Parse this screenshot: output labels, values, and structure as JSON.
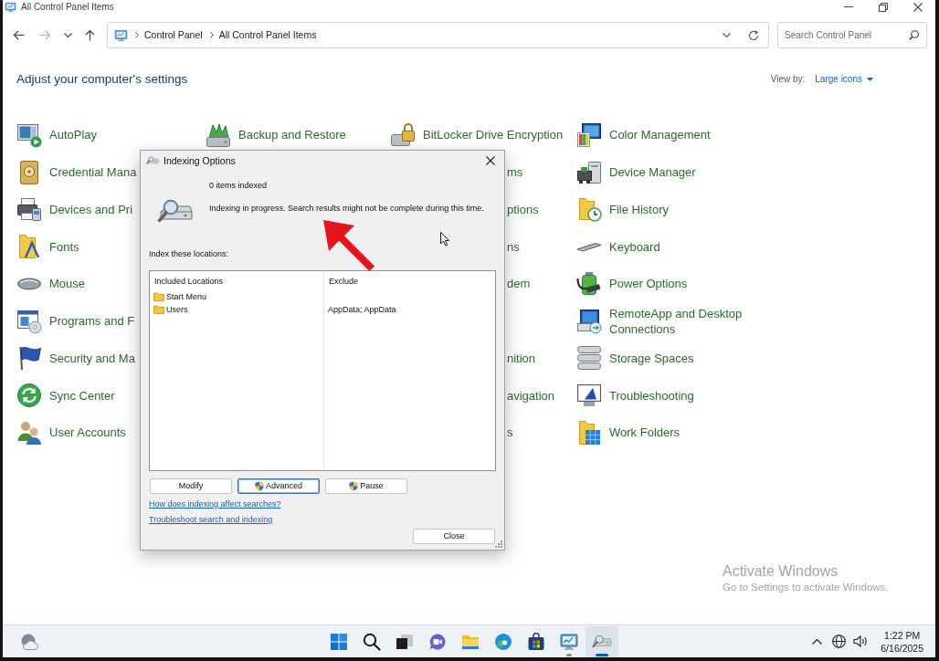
{
  "window": {
    "title": "All Control Panel Items"
  },
  "back_button": {
    "disabled": false
  },
  "forward_button": {
    "disabled": true
  },
  "address_bar": {
    "breadcrumbs": [
      "Control Panel",
      "All Control Panel Items"
    ]
  },
  "search": {
    "placeholder": "Search Control Panel"
  },
  "control_panel": {
    "heading": "Adjust your computer's settings",
    "view_by": {
      "label": "View by:",
      "value": "Large icons"
    },
    "rows": [
      {
        "cells": [
          {
            "kind": "item",
            "label": "AutoPlay"
          },
          {
            "kind": "item",
            "label": "Backup and Restore"
          },
          {
            "kind": "item",
            "label": "BitLocker Drive Encryption"
          },
          {
            "kind": "item",
            "label": "Color Management"
          }
        ]
      },
      {
        "cells": [
          {
            "kind": "item",
            "label": "Credential Mana"
          },
          {
            "kind": "covered"
          },
          {
            "kind": "tail",
            "label": "ms"
          },
          {
            "kind": "item",
            "label": "Device Manager"
          }
        ]
      },
      {
        "cells": [
          {
            "kind": "item",
            "label": "Devices and Pri"
          },
          {
            "kind": "covered"
          },
          {
            "kind": "tail",
            "label": "ptions"
          },
          {
            "kind": "item",
            "label": "File History"
          }
        ]
      },
      {
        "cells": [
          {
            "kind": "item",
            "label": "Fonts"
          },
          {
            "kind": "covered"
          },
          {
            "kind": "tail",
            "label": "ns"
          },
          {
            "kind": "item",
            "label": "Keyboard"
          }
        ]
      },
      {
        "cells": [
          {
            "kind": "item",
            "label": "Mouse"
          },
          {
            "kind": "covered"
          },
          {
            "kind": "tail",
            "label": "dem"
          },
          {
            "kind": "item",
            "label": "Power Options"
          }
        ]
      },
      {
        "cells": [
          {
            "kind": "item",
            "label": "Programs and F"
          },
          {
            "kind": "covered"
          },
          {
            "kind": "covered"
          },
          {
            "kind": "item",
            "label": "RemoteApp and Desktop Connections"
          }
        ]
      },
      {
        "cells": [
          {
            "kind": "item",
            "label": "Security and Ma"
          },
          {
            "kind": "covered"
          },
          {
            "kind": "tail",
            "label": "nition"
          },
          {
            "kind": "item",
            "label": "Storage Spaces"
          }
        ]
      },
      {
        "cells": [
          {
            "kind": "item",
            "label": "Sync Center"
          },
          {
            "kind": "covered"
          },
          {
            "kind": "tail",
            "label": "avigation"
          },
          {
            "kind": "item",
            "label": "Troubleshooting"
          }
        ]
      },
      {
        "cells": [
          {
            "kind": "item",
            "label": "User Accounts"
          },
          {
            "kind": "covered"
          },
          {
            "kind": "tail",
            "label": "s"
          },
          {
            "kind": "item",
            "label": "Work Folders"
          }
        ]
      }
    ]
  },
  "dialog": {
    "title": "Indexing Options",
    "status": "0 items indexed",
    "message": "Indexing in progress. Search results might not be complete during this time.",
    "locations_label": "Index these locations:",
    "columns": [
      "Included Locations",
      "Exclude"
    ],
    "locations": [
      {
        "name": "Start Menu"
      },
      {
        "name": "Users",
        "exclude": "AppData; AppData"
      }
    ],
    "buttons": [
      {
        "label": "Modify",
        "elevated": false,
        "focused": false
      },
      {
        "label": "Advanced",
        "elevated": true,
        "focused": true
      },
      {
        "label": "Pause",
        "elevated": true,
        "focused": false
      }
    ],
    "links": [
      "How does indexing affect searches?",
      "Troubleshoot search and indexing"
    ],
    "close_label": "Close"
  },
  "activation_notice": {
    "title": "Activate Windows",
    "message": "Go to Settings to activate Windows."
  },
  "taskbar": {
    "apps": [
      {
        "open": false,
        "selected": false
      },
      {
        "open": false,
        "selected": false
      },
      {
        "open": false,
        "selected": false
      },
      {
        "open": false,
        "selected": false
      },
      {
        "open": false,
        "selected": false
      },
      {
        "open": true,
        "selected": false
      },
      {
        "open": true,
        "selected": true
      }
    ],
    "clock": {
      "time": "1:22 PM",
      "date": "6/16/2025"
    }
  }
}
